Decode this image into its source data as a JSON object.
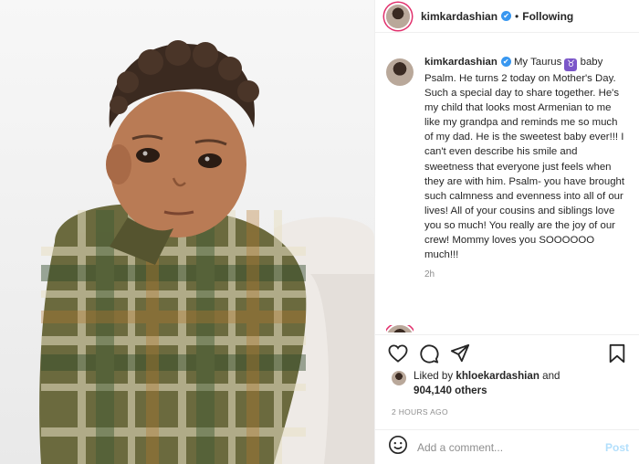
{
  "post": {
    "username": "kimkardashian",
    "verified_glyph": "✔",
    "follow_separator": "•",
    "follow_status": "Following",
    "image_alt": "Toddler in plaid shirt"
  },
  "caption": {
    "username": "kimkardashian",
    "text_before_badge": " My Taurus ",
    "badge_glyph": "♉",
    "text_after_badge": " baby Psalm. He turns 2 today on Mother's Day. Such a special day to share together. He's my child that looks most Armenian to me like my grandpa and reminds me so much of my dad. He is the sweetest baby ever!!! I can't even describe his smile and sweetness that everyone just feels when they are with him. Psalm- you have brought such calmness and evenness into all of our lives! All of your cousins and siblings love you so much! You really are the joy of our crew! Mommy loves you SOOOOOO much!!!",
    "time_ago": "2h"
  },
  "actions": {
    "like_icon": "heart-icon",
    "comment_icon": "comment-icon",
    "share_icon": "share-icon",
    "save_icon": "bookmark-icon"
  },
  "likes": {
    "prefix": "Liked by ",
    "liked_by_user": "khloekardashian",
    "connector": " and",
    "others_count": "904,140 others"
  },
  "timestamp": "2 HOURS AGO",
  "comment_box": {
    "emoji_icon": "emoji-icon",
    "placeholder": "Add a comment...",
    "post_label": "Post"
  },
  "colors": {
    "link_blue": "#3897f0",
    "post_disabled": "#b2dffc",
    "secondary_text": "#8e8e8e",
    "taurus_purple": "#7b56c9"
  }
}
